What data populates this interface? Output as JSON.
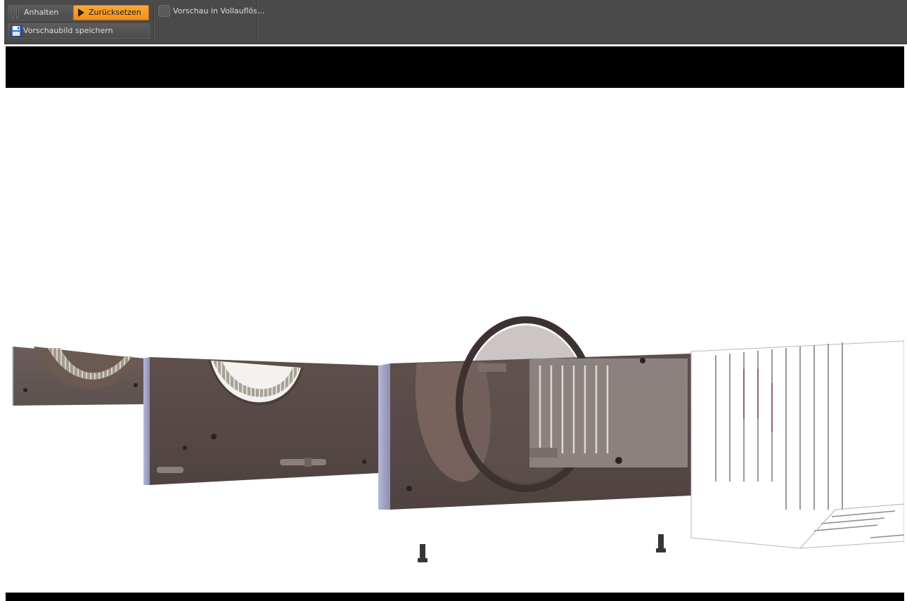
{
  "toolbar": {
    "pause_label": "Anhalten",
    "reset_label": "Zurücksetzen",
    "save_preview_label": "Vorschaubild speichern",
    "fullres_label": "Vorschau in Vollauflös...",
    "fullres_checked": false,
    "icons": {
      "pause": "pause-icon",
      "reset": "play-icon",
      "save": "floppy-disk-icon"
    }
  },
  "viewport": {
    "background": "#000000",
    "render_background": "#ffffff"
  },
  "colors": {
    "toolbar_bg": "#4a4a4a",
    "accent": "#f39a22"
  }
}
